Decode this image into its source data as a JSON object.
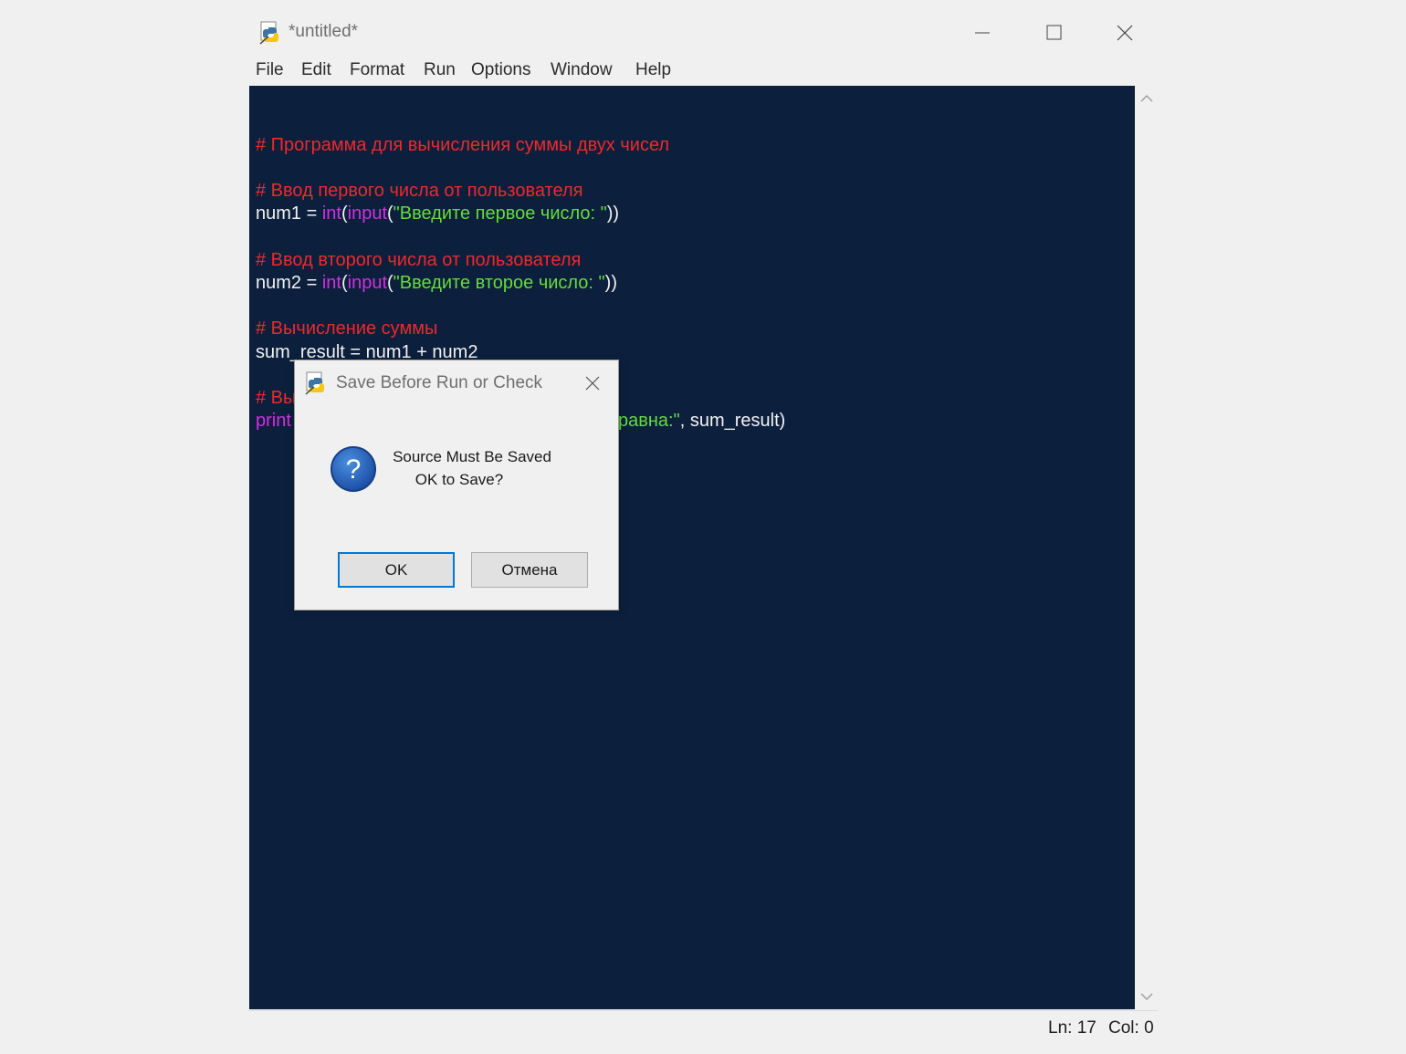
{
  "window": {
    "title": "*untitled*"
  },
  "menu": [
    "File",
    "Edit",
    "Format",
    "Run",
    "Options",
    "Window",
    "Help"
  ],
  "code": {
    "l3": "# Программа для вычисления суммы двух чисел",
    "l5": "# Ввод первого числа от пользователя",
    "l6": {
      "a": "num1 = ",
      "b": "int",
      "c": "(",
      "d": "input",
      "e": "(",
      "f": "\"Введите первое число: \"",
      "g": "))"
    },
    "l8": "# Ввод второго числа от пользователя",
    "l9": {
      "a": "num2 = ",
      "b": "int",
      "c": "(",
      "d": "input",
      "e": "(",
      "f": "\"Введите второе число: \"",
      "g": "))"
    },
    "l11": "# Вычисление суммы",
    "l12": "sum_result = num1 + num2",
    "l14": "# Вы",
    "l15": {
      "a": "print",
      "b": "равна:\"",
      "c": ", sum_result)"
    }
  },
  "status": {
    "ln": "Ln: 17",
    "col": "Col: 0"
  },
  "dialog": {
    "title": "Save Before Run or Check",
    "message_line1": "Source Must Be Saved",
    "message_line2": "OK to Save?",
    "ok_label": "OK",
    "cancel_label": "Отмена"
  },
  "colors": {
    "editor_bg": "#0c1f3d",
    "comment": "#ec2a2a",
    "builtin": "#d42fe0",
    "string": "#64dc3c",
    "plain": "#f2f2f2"
  },
  "icons": [
    "idle-python-icon",
    "minimize-icon",
    "maximize-icon",
    "close-icon",
    "scroll-up-icon",
    "scroll-down-icon",
    "question-icon"
  ]
}
